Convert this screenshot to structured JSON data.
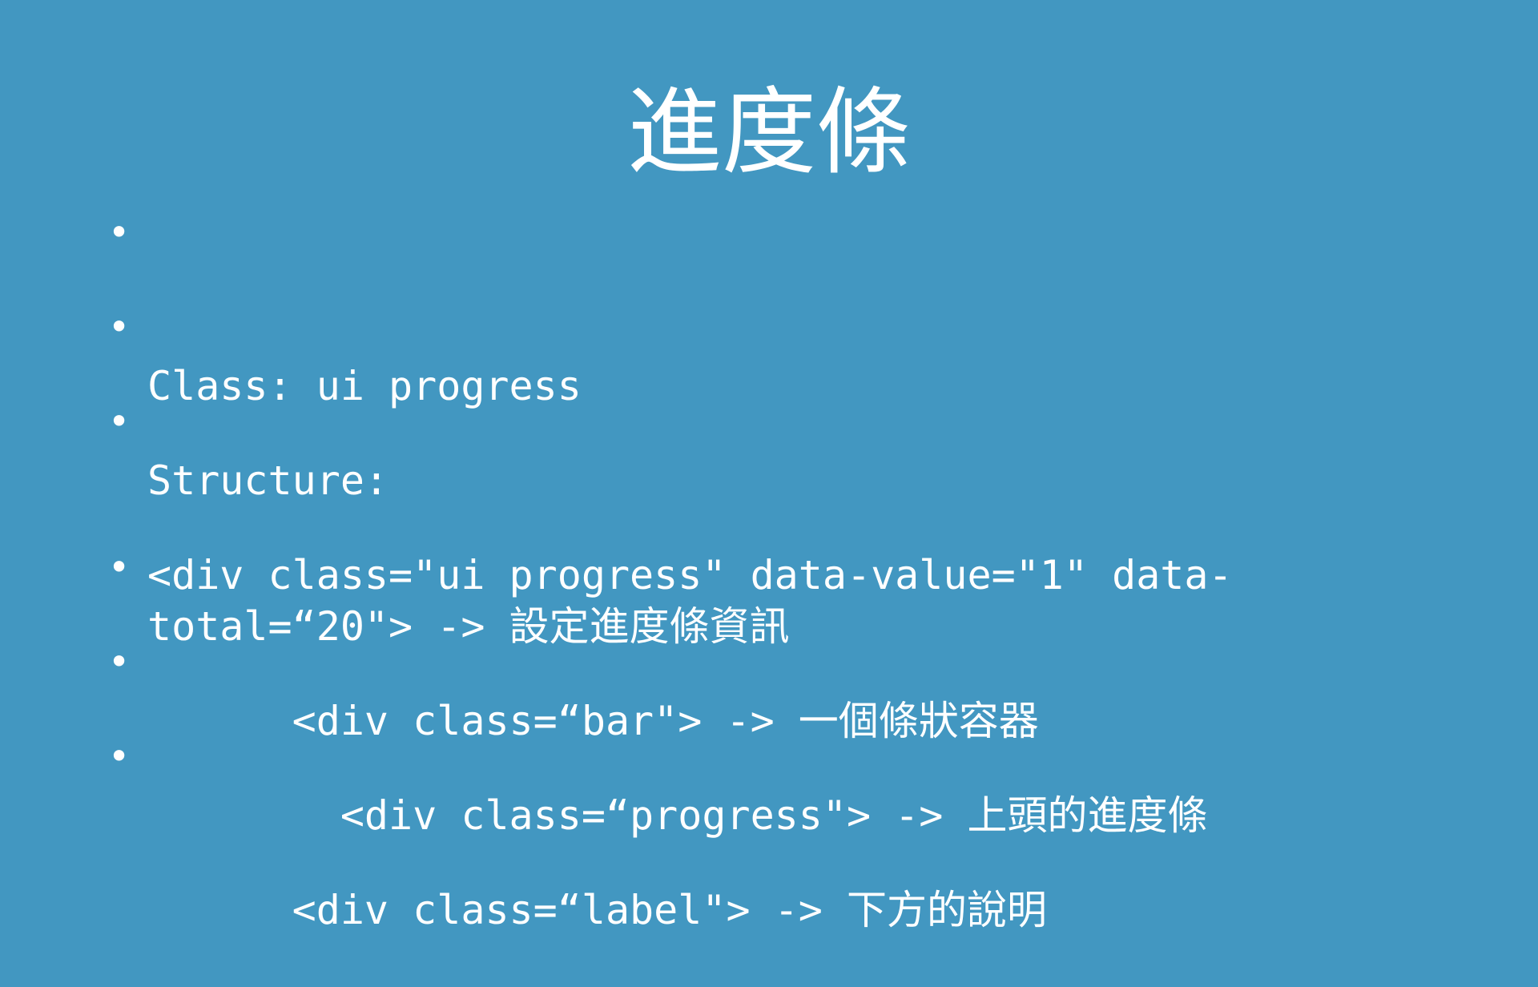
{
  "slide": {
    "title": "進度條",
    "bullet_symbol": "•",
    "bullets": [
      "Class: ui progress",
      "Structure:",
      "<div class=\"ui progress\" data-value=\"1\" data-total=“20\"> -> 設定進度條資訊",
      "      <div class=“bar\"> -> 一個條狀容器",
      "        <div class=“progress\"> -> 上頭的進度條",
      "      <div class=“label\"> -> 下方的說明"
    ]
  }
}
